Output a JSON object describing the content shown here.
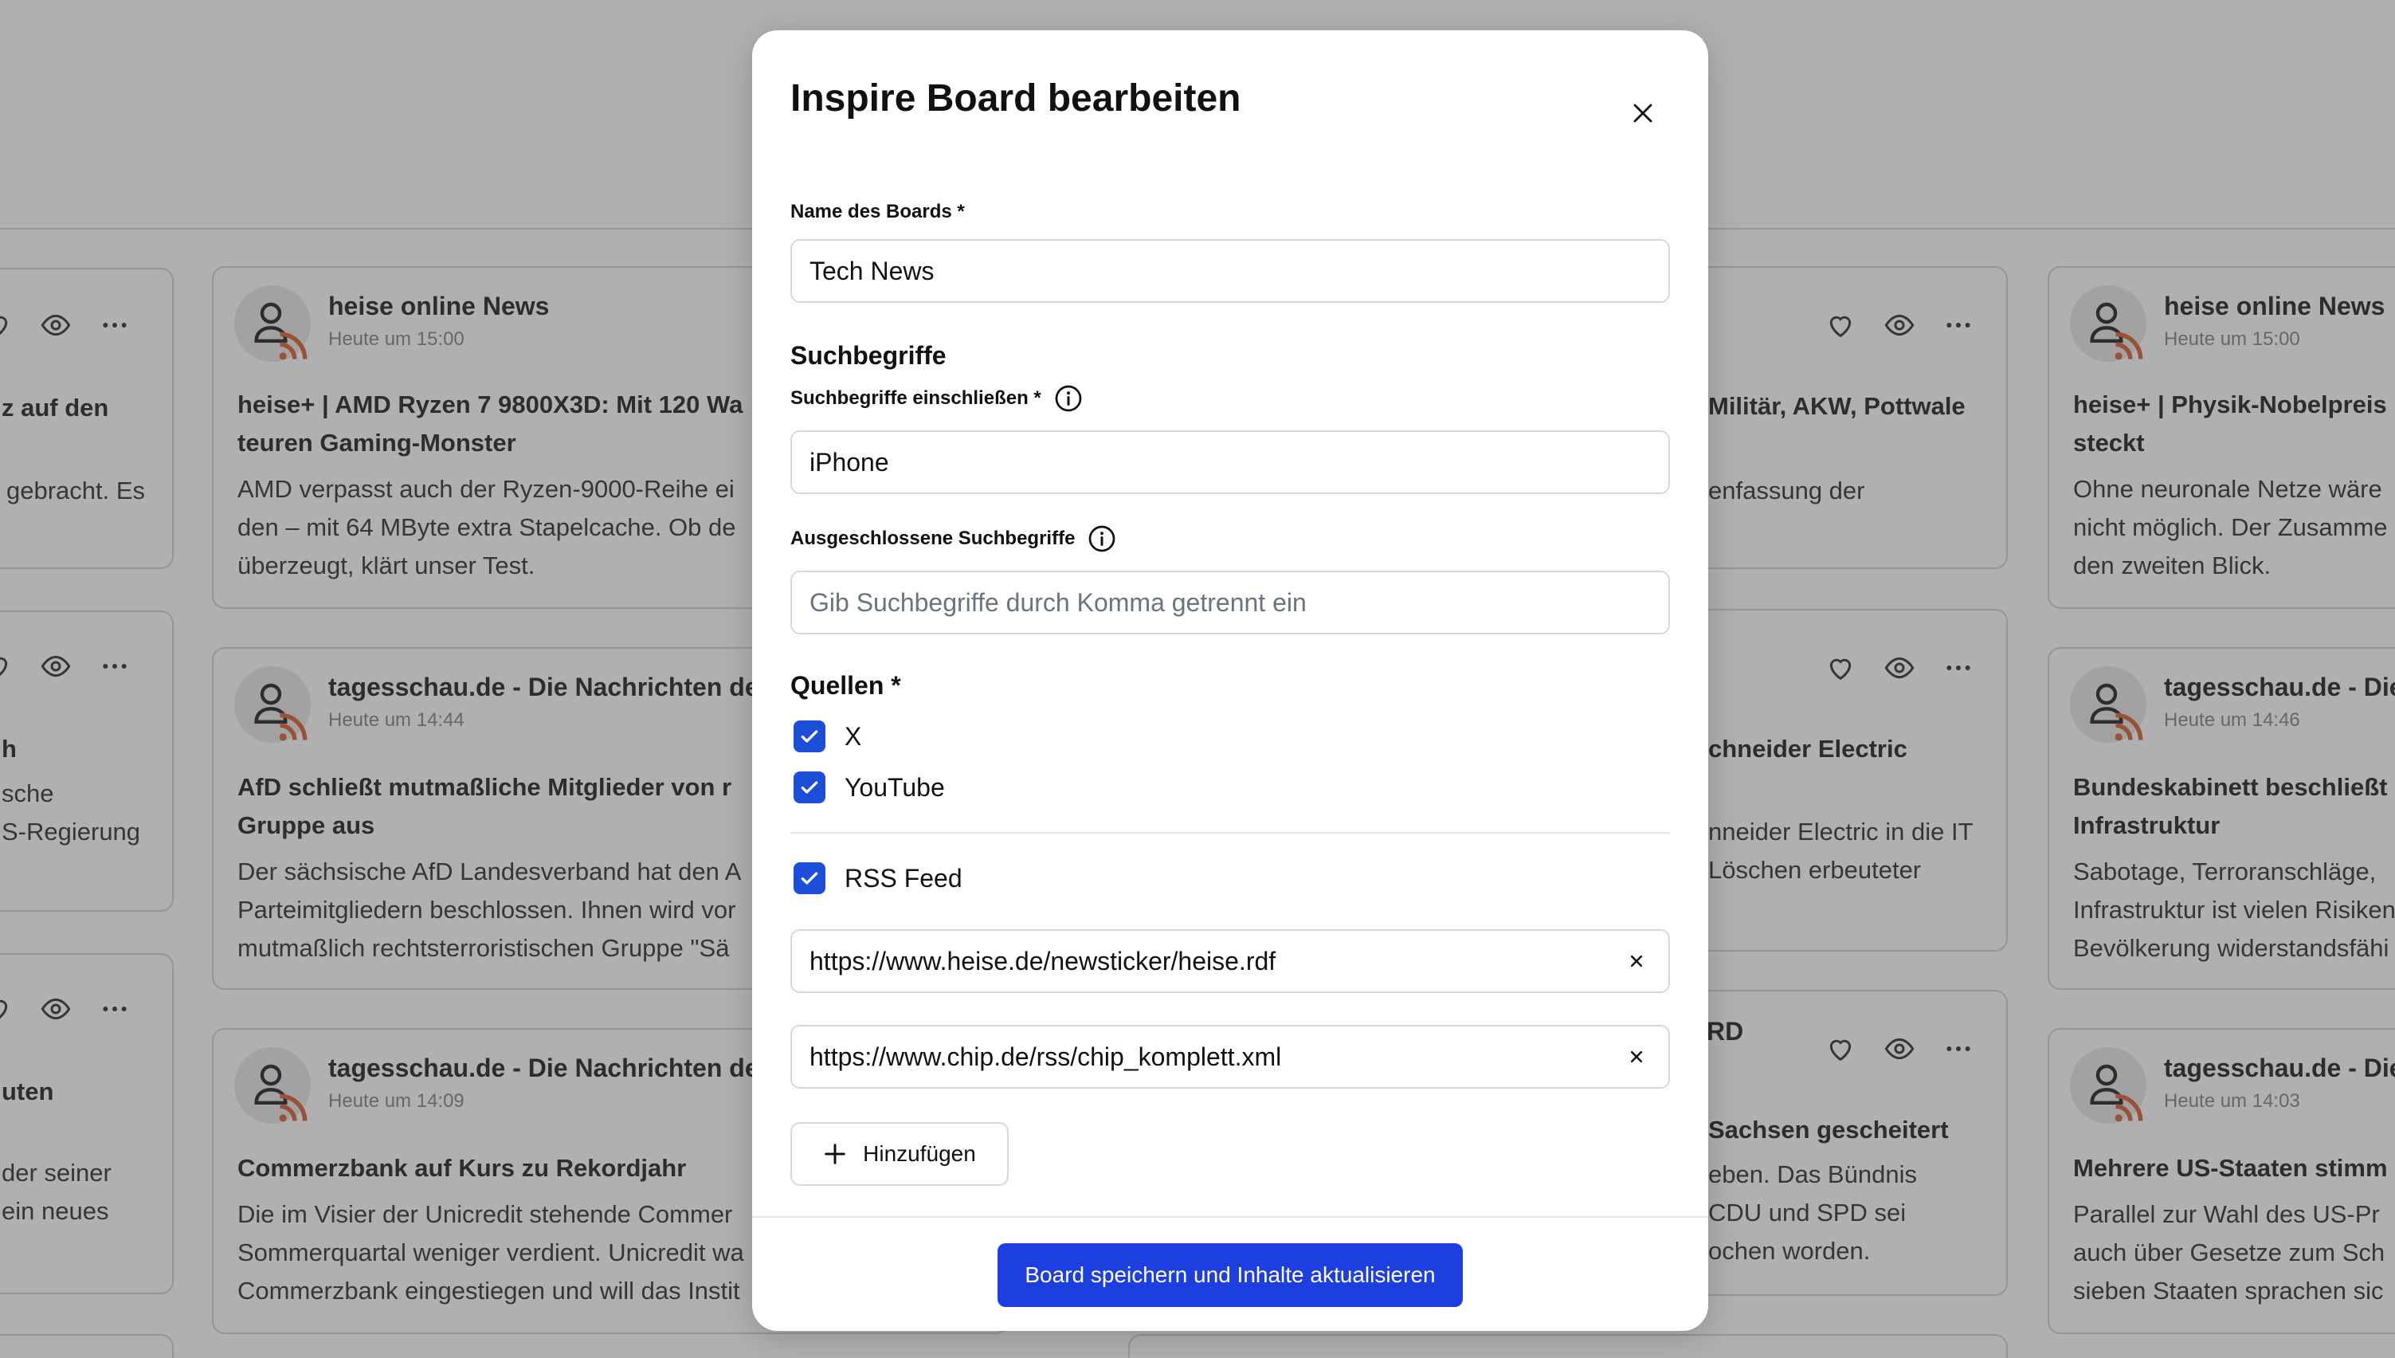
{
  "background": {
    "columns": [
      {
        "cards": [
          {
            "title": "z auf den",
            "body": [
              "gebracht. Es"
            ]
          },
          {
            "title": "h",
            "body": [
              "sche",
              "S-Regierung"
            ]
          },
          {
            "title": "uten",
            "body": [
              "der seiner",
              "ein neues"
            ]
          }
        ]
      },
      {
        "cards": [
          {
            "source": "heise online News",
            "time": "Heute um 15:00",
            "title": "heise+ | AMD Ryzen 7 9800X3D: Mit 120 Wa teuren Gaming-Monster",
            "title_l1": "heise+ | AMD Ryzen 7 9800X3D: Mit 120 Wa",
            "title_l2": "teuren Gaming-Monster",
            "body": [
              "AMD verpasst auch der Ryzen-9000-Reihe ei",
              "den – mit 64 MByte extra Stapelcache. Ob de",
              "überzeugt, klärt unser Test."
            ]
          },
          {
            "source": "tagesschau.de - Die Nachrichten de",
            "time": "Heute um 14:44",
            "title_l1": "AfD schließt mutmaßliche Mitglieder von r",
            "title_l2": "Gruppe aus",
            "body": [
              "Der sächsische AfD Landesverband hat den A",
              "Parteimitgliedern beschlossen. Ihnen wird vor",
              "mutmaßlich rechtsterroristischen Gruppe \"Sä"
            ]
          },
          {
            "source": "tagesschau.de - Die Nachrichten de",
            "time": "Heute um 14:09",
            "title_l1": "Commerzbank auf Kurs zu Rekordjahr",
            "body": [
              "Die im Visier der Unicredit stehende Commer",
              "Sommerquartal weniger verdient. Unicredit wa",
              "Commerzbank eingestiegen und will das Instit"
            ]
          }
        ]
      },
      {
        "cards": [
          {
            "title": "Militär, AKW, Pottwale",
            "body": [
              "enfassung der"
            ]
          },
          {
            "title": "chneider Electric",
            "body": [
              "nneider Electric in die IT",
              "Löschen erbeuteter"
            ]
          },
          {
            "source_tail": "RD",
            "title": "Sachsen gescheitert",
            "body": [
              "eben. Das Bündnis",
              "CDU und SPD sei",
              "ochen worden."
            ]
          }
        ]
      },
      {
        "cards": [
          {
            "source": "heise online News",
            "time": "Heute um 15:00",
            "title_l1": "heise+ | Physik-Nobelpreis",
            "title_l2": "steckt",
            "body": [
              "Ohne neuronale Netze wäre",
              "nicht möglich. Der Zusamme",
              "den zweiten Blick."
            ]
          },
          {
            "source": "tagesschau.de - Die",
            "time": "Heute um 14:46",
            "title_l1": "Bundeskabinett beschließt",
            "title_l2": "Infrastruktur",
            "body": [
              "Sabotage, Terroranschläge,",
              "Infrastruktur ist vielen Risiken",
              "Bevölkerung widerstandsfähi"
            ]
          },
          {
            "source": "tagesschau.de - Die",
            "time": "Heute um 14:03",
            "title_l1": "Mehrere US-Staaten stimm",
            "body": [
              "Parallel zur Wahl des US-Pr",
              "auch über Gesetze zum Sch",
              "sieben Staaten sprachen sic"
            ]
          }
        ]
      }
    ]
  },
  "modal": {
    "title": "Inspire Board bearbeiten",
    "board_name_label": "Name des Boards *",
    "board_name_value": "Tech News",
    "search_terms_section": "Suchbegriffe",
    "include_label": "Suchbegriffe einschließen *",
    "include_value": "iPhone",
    "exclude_label": "Ausgeschlossene Suchbegriffe",
    "exclude_placeholder": "Gib Suchbegriffe durch Komma getrennt ein",
    "sources_section": "Quellen *",
    "sources": [
      {
        "label": "X",
        "checked": true
      },
      {
        "label": "YouTube",
        "checked": true
      },
      {
        "label": "RSS Feed",
        "checked": true
      }
    ],
    "rss_urls": [
      "https://www.heise.de/newsticker/heise.rdf",
      "https://www.chip.de/rss/chip_komplett.xml"
    ],
    "add_label": "Hinzufügen",
    "save_label": "Board speichern und Inhalte aktualisieren"
  },
  "colors": {
    "primary": "#1d3fe0",
    "checkbox": "#1d4ed8",
    "rss_orange": "#d9531e",
    "overlay": "rgba(80,80,80,0.45)"
  },
  "icons": {
    "close": "close-icon",
    "info": "info-icon",
    "check": "check-icon",
    "clear": "clear-icon",
    "plus": "plus-icon",
    "heart": "heart-icon",
    "eye": "eye-icon",
    "more": "more-icon",
    "rss": "rss-icon",
    "person": "person-icon"
  }
}
